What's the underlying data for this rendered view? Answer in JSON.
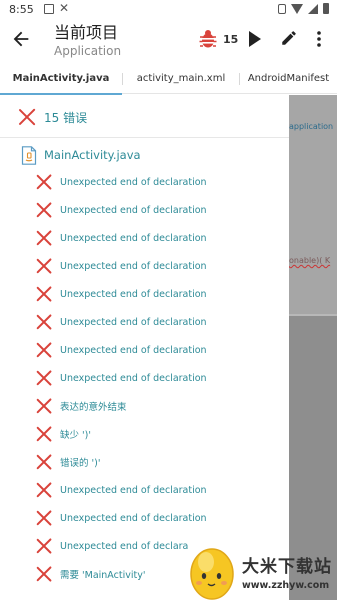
{
  "status_bar": {
    "time": "8:55"
  },
  "toolbar": {
    "title": "当前项目",
    "subtitle": "Application",
    "bug_count": "15"
  },
  "tabs": [
    {
      "label": "MainActivity.java",
      "selected": true
    },
    {
      "label": "activity_main.xml",
      "selected": false
    },
    {
      "label": "AndroidManifest",
      "selected": false
    }
  ],
  "editor_fragments": {
    "line_1": "application",
    "line_2": "onable)( K"
  },
  "panel": {
    "error_count_label": "15 错误",
    "file_name": "MainActivity.java",
    "errors": [
      "Unexpected end of declaration",
      "Unexpected end of declaration",
      "Unexpected end of declaration",
      "Unexpected end of declaration",
      "Unexpected end of declaration",
      "Unexpected end of declaration",
      "Unexpected end of declaration",
      "Unexpected end of declaration",
      "表达的意外结束",
      "缺少 ')'",
      "错误的 ')'",
      "Unexpected end of declaration",
      "Unexpected end of declaration",
      "Unexpected end of declarat",
      "需要 'MainActivity'"
    ]
  },
  "colors": {
    "accent": "#2e8b97",
    "error_red": "#d9433b",
    "tab_indicator": "#5fa8d3"
  },
  "watermark": {
    "title": "大米下载站",
    "url": "www.zzhyw.com"
  }
}
